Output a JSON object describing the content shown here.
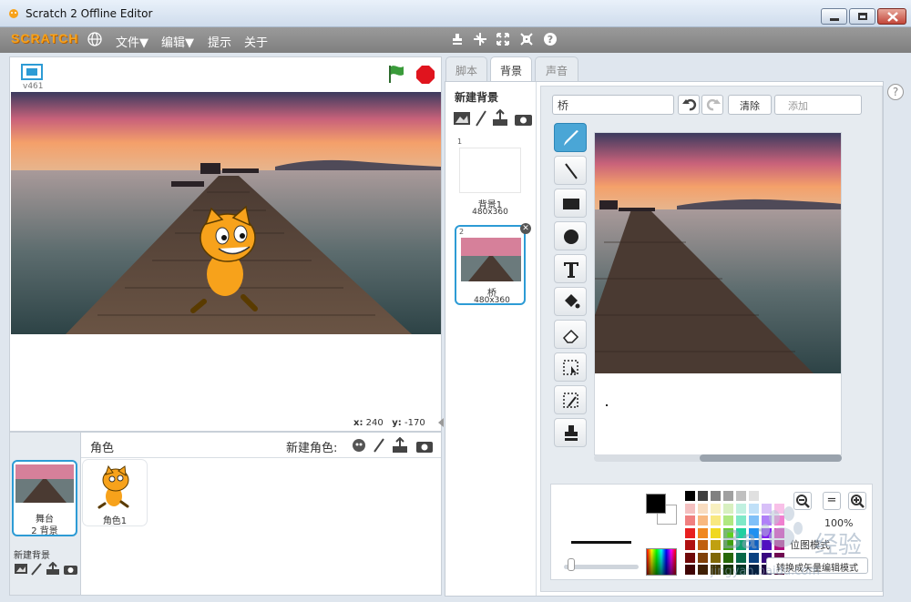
{
  "window": {
    "title": "Scratch 2 Offline Editor"
  },
  "menubar": {
    "logo_text": "SCRATCH",
    "items": [
      "文件▼",
      "编辑▼",
      "提示",
      "关于"
    ],
    "globe_icon": "globe-icon",
    "tool_icons": [
      "duplicate-stamp-icon",
      "delete-scissors-icon",
      "grow-icon",
      "shrink-icon",
      "help-icon"
    ]
  },
  "stage": {
    "version": "v461",
    "coords": {
      "x_label": "x:",
      "x_value": "240",
      "y_label": "y:",
      "y_value": "-170"
    }
  },
  "sprites": {
    "stage_label": "舞台",
    "stage_sub": "2 背景",
    "new_backdrop_label": "新建背景",
    "header_title": "角色",
    "new_sprite_label": "新建角色:",
    "items": [
      {
        "name": "角色1"
      }
    ]
  },
  "tabs": {
    "scripts": "脚本",
    "backdrops": "背景",
    "sounds": "声音"
  },
  "backdrops": {
    "new_title": "新建背景",
    "list": [
      {
        "num": "1",
        "name": "背景1",
        "size": "480x360"
      },
      {
        "num": "2",
        "name": "桥",
        "size": "480x360"
      }
    ]
  },
  "paint_editor": {
    "name_value": "桥",
    "clear_label": "清除",
    "add_label": "添加",
    "zoom_level": "100%",
    "mode_label": "位图模式",
    "convert_label": "转换成矢量编辑模式",
    "help_symbol": "?"
  },
  "colors": {
    "accent": "#2d9bd5",
    "menubar": "#8a8a8a",
    "flag": "#2e8b3a",
    "stop": "#e0141e"
  },
  "watermark": {
    "text1": "Bai",
    "text2": "经验",
    "text3": "jingyan.baidu.com"
  }
}
